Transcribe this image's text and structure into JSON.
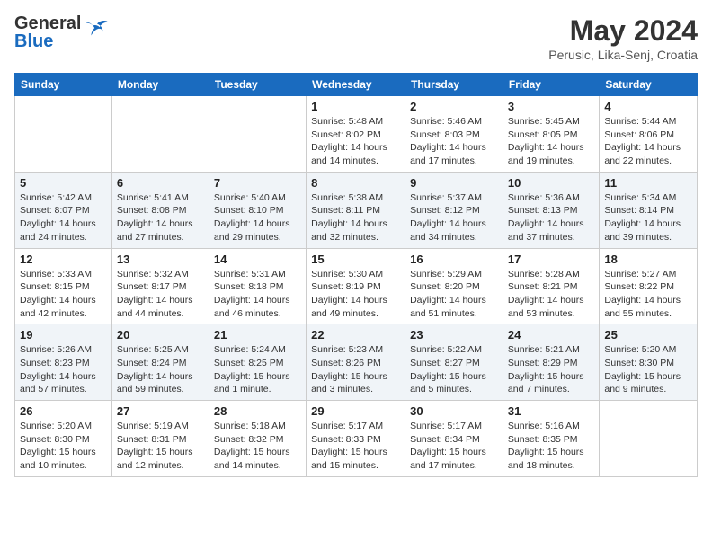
{
  "header": {
    "logo_line1": "General",
    "logo_line2": "Blue",
    "month_year": "May 2024",
    "location": "Perusic, Lika-Senj, Croatia"
  },
  "days_of_week": [
    "Sunday",
    "Monday",
    "Tuesday",
    "Wednesday",
    "Thursday",
    "Friday",
    "Saturday"
  ],
  "weeks": [
    [
      {
        "day": "",
        "info": ""
      },
      {
        "day": "",
        "info": ""
      },
      {
        "day": "",
        "info": ""
      },
      {
        "day": "1",
        "info": "Sunrise: 5:48 AM\nSunset: 8:02 PM\nDaylight: 14 hours\nand 14 minutes."
      },
      {
        "day": "2",
        "info": "Sunrise: 5:46 AM\nSunset: 8:03 PM\nDaylight: 14 hours\nand 17 minutes."
      },
      {
        "day": "3",
        "info": "Sunrise: 5:45 AM\nSunset: 8:05 PM\nDaylight: 14 hours\nand 19 minutes."
      },
      {
        "day": "4",
        "info": "Sunrise: 5:44 AM\nSunset: 8:06 PM\nDaylight: 14 hours\nand 22 minutes."
      }
    ],
    [
      {
        "day": "5",
        "info": "Sunrise: 5:42 AM\nSunset: 8:07 PM\nDaylight: 14 hours\nand 24 minutes."
      },
      {
        "day": "6",
        "info": "Sunrise: 5:41 AM\nSunset: 8:08 PM\nDaylight: 14 hours\nand 27 minutes."
      },
      {
        "day": "7",
        "info": "Sunrise: 5:40 AM\nSunset: 8:10 PM\nDaylight: 14 hours\nand 29 minutes."
      },
      {
        "day": "8",
        "info": "Sunrise: 5:38 AM\nSunset: 8:11 PM\nDaylight: 14 hours\nand 32 minutes."
      },
      {
        "day": "9",
        "info": "Sunrise: 5:37 AM\nSunset: 8:12 PM\nDaylight: 14 hours\nand 34 minutes."
      },
      {
        "day": "10",
        "info": "Sunrise: 5:36 AM\nSunset: 8:13 PM\nDaylight: 14 hours\nand 37 minutes."
      },
      {
        "day": "11",
        "info": "Sunrise: 5:34 AM\nSunset: 8:14 PM\nDaylight: 14 hours\nand 39 minutes."
      }
    ],
    [
      {
        "day": "12",
        "info": "Sunrise: 5:33 AM\nSunset: 8:15 PM\nDaylight: 14 hours\nand 42 minutes."
      },
      {
        "day": "13",
        "info": "Sunrise: 5:32 AM\nSunset: 8:17 PM\nDaylight: 14 hours\nand 44 minutes."
      },
      {
        "day": "14",
        "info": "Sunrise: 5:31 AM\nSunset: 8:18 PM\nDaylight: 14 hours\nand 46 minutes."
      },
      {
        "day": "15",
        "info": "Sunrise: 5:30 AM\nSunset: 8:19 PM\nDaylight: 14 hours\nand 49 minutes."
      },
      {
        "day": "16",
        "info": "Sunrise: 5:29 AM\nSunset: 8:20 PM\nDaylight: 14 hours\nand 51 minutes."
      },
      {
        "day": "17",
        "info": "Sunrise: 5:28 AM\nSunset: 8:21 PM\nDaylight: 14 hours\nand 53 minutes."
      },
      {
        "day": "18",
        "info": "Sunrise: 5:27 AM\nSunset: 8:22 PM\nDaylight: 14 hours\nand 55 minutes."
      }
    ],
    [
      {
        "day": "19",
        "info": "Sunrise: 5:26 AM\nSunset: 8:23 PM\nDaylight: 14 hours\nand 57 minutes."
      },
      {
        "day": "20",
        "info": "Sunrise: 5:25 AM\nSunset: 8:24 PM\nDaylight: 14 hours\nand 59 minutes."
      },
      {
        "day": "21",
        "info": "Sunrise: 5:24 AM\nSunset: 8:25 PM\nDaylight: 15 hours\nand 1 minute."
      },
      {
        "day": "22",
        "info": "Sunrise: 5:23 AM\nSunset: 8:26 PM\nDaylight: 15 hours\nand 3 minutes."
      },
      {
        "day": "23",
        "info": "Sunrise: 5:22 AM\nSunset: 8:27 PM\nDaylight: 15 hours\nand 5 minutes."
      },
      {
        "day": "24",
        "info": "Sunrise: 5:21 AM\nSunset: 8:29 PM\nDaylight: 15 hours\nand 7 minutes."
      },
      {
        "day": "25",
        "info": "Sunrise: 5:20 AM\nSunset: 8:30 PM\nDaylight: 15 hours\nand 9 minutes."
      }
    ],
    [
      {
        "day": "26",
        "info": "Sunrise: 5:20 AM\nSunset: 8:30 PM\nDaylight: 15 hours\nand 10 minutes."
      },
      {
        "day": "27",
        "info": "Sunrise: 5:19 AM\nSunset: 8:31 PM\nDaylight: 15 hours\nand 12 minutes."
      },
      {
        "day": "28",
        "info": "Sunrise: 5:18 AM\nSunset: 8:32 PM\nDaylight: 15 hours\nand 14 minutes."
      },
      {
        "day": "29",
        "info": "Sunrise: 5:17 AM\nSunset: 8:33 PM\nDaylight: 15 hours\nand 15 minutes."
      },
      {
        "day": "30",
        "info": "Sunrise: 5:17 AM\nSunset: 8:34 PM\nDaylight: 15 hours\nand 17 minutes."
      },
      {
        "day": "31",
        "info": "Sunrise: 5:16 AM\nSunset: 8:35 PM\nDaylight: 15 hours\nand 18 minutes."
      },
      {
        "day": "",
        "info": ""
      }
    ]
  ]
}
